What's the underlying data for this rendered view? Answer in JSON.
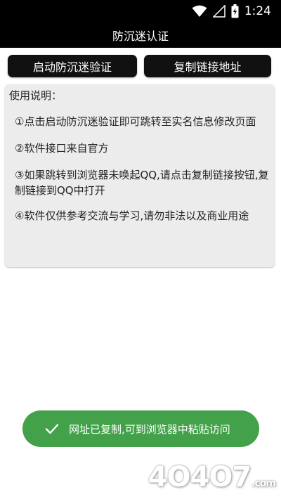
{
  "status_bar": {
    "time": "1:24",
    "icons": [
      "wifi-icon",
      "signal-icon",
      "battery-icon"
    ]
  },
  "app": {
    "title": "防沉迷认证"
  },
  "buttons": {
    "launch_label": "启动防沉迷验证",
    "copy_label": "复制链接地址"
  },
  "instructions": {
    "heading": "使用说明：",
    "items": [
      "①点击启动防沉迷验证即可跳转至实名信息修改页面",
      "②软件接口来自官方",
      "③如果跳转到浏览器未唤起QQ,请点击复制链接按钮,复制链接到QQ中打开",
      "④软件仅供参考交流与学习,请勿非法以及商业用途"
    ]
  },
  "toast": {
    "message": "网址已复制,可到浏览器中粘贴访问",
    "icon": "check-icon"
  },
  "watermark": {
    "text": "4O4O7",
    "domain": ".com"
  },
  "colors": {
    "toast_bg": "#43a14a",
    "button_bg": "#111111",
    "card_bg": "#ececec",
    "bar_bg": "#000000"
  }
}
